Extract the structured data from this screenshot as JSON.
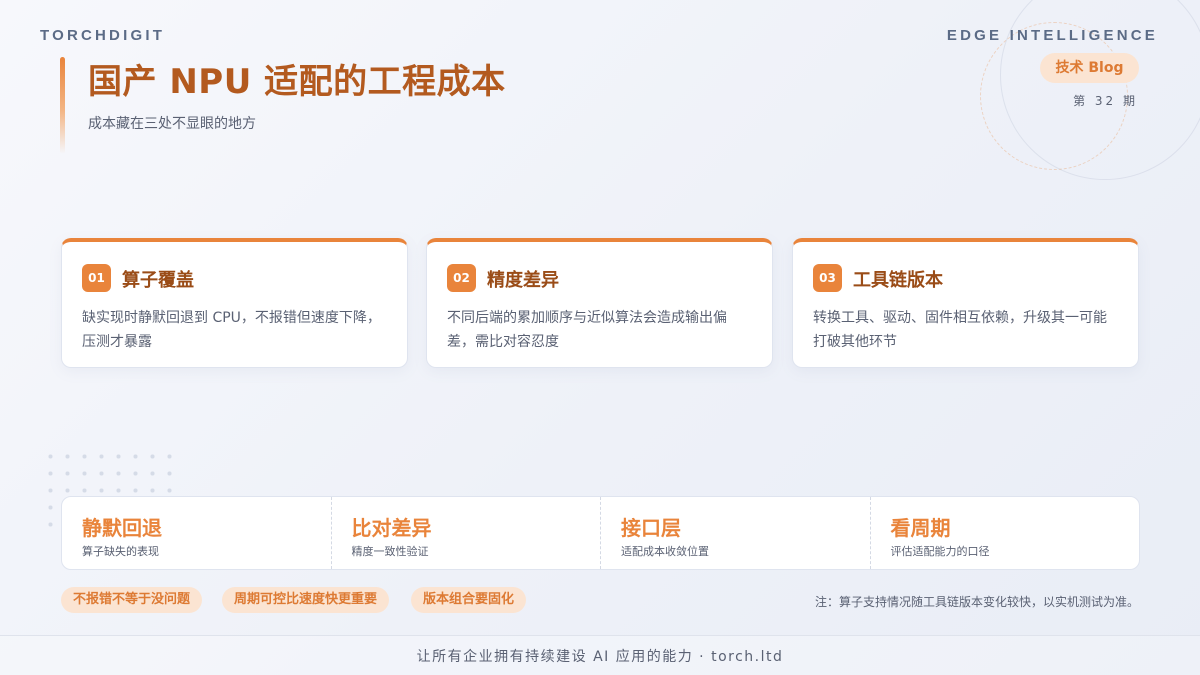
{
  "header": {
    "brand_left": "TORCHDIGIT",
    "brand_right": "EDGE INTELLIGENCE",
    "title": "国产 NPU 适配的工程成本",
    "subtitle": "成本藏在三处不显眼的地方",
    "tag": "技术 Blog",
    "issue": "第 32 期"
  },
  "cards": [
    {
      "num": "01",
      "title": "算子覆盖",
      "desc": "缺实现时静默回退到 CPU，不报错但速度下降，压测才暴露"
    },
    {
      "num": "02",
      "title": "精度差异",
      "desc": "不同后端的累加顺序与近似算法会造成输出偏差，需比对容忍度"
    },
    {
      "num": "03",
      "title": "工具链版本",
      "desc": "转换工具、驱动、固件相互依赖，升级其一可能打破其他环节"
    }
  ],
  "stats": [
    {
      "value": "静默回退",
      "label": "算子缺失的表现"
    },
    {
      "value": "比对差异",
      "label": "精度一致性验证"
    },
    {
      "value": "接口层",
      "label": "适配成本收敛位置"
    },
    {
      "value": "看周期",
      "label": "评估适配能力的口径"
    }
  ],
  "chips": [
    "不报错不等于没问题",
    "周期可控比速度快更重要",
    "版本组合要固化"
  ],
  "note": "注：算子支持情况随工具链版本变化较快，以实机测试为准。",
  "footer": "让所有企业拥有持续建设 AI 应用的能力 · torch.ltd",
  "colors": {
    "accent": "#e9843b",
    "title": "#b35a1f",
    "card_title": "#9a4c17",
    "chip_bg": "#fbe4d2"
  }
}
